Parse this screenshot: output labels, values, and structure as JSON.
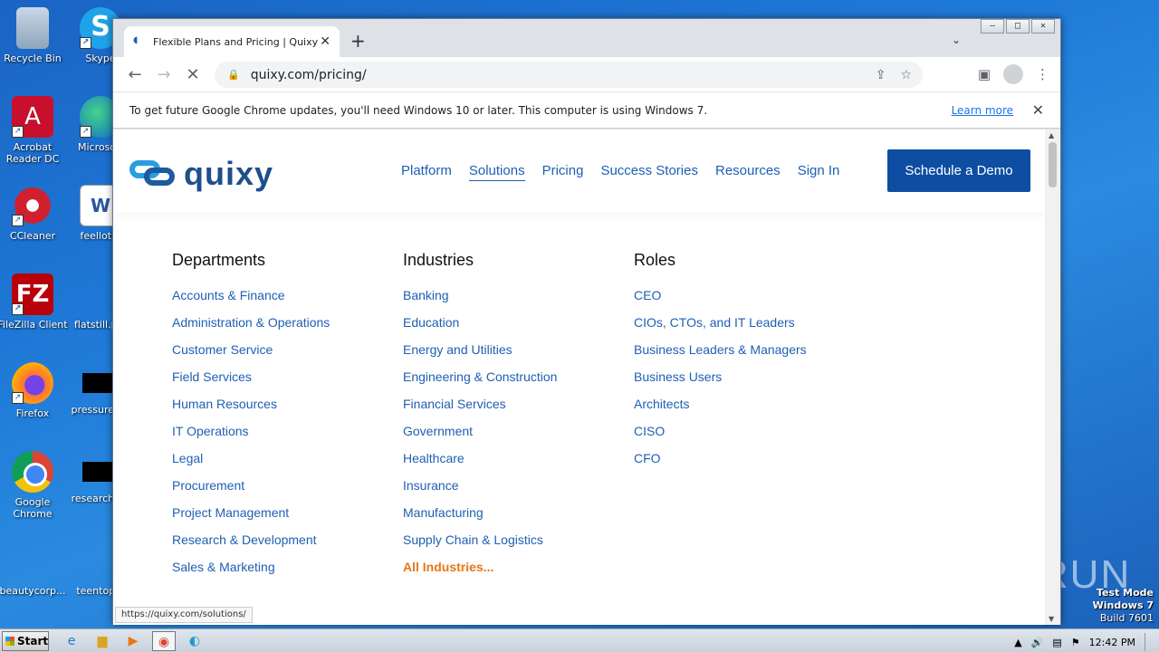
{
  "desktop": {
    "icons": [
      {
        "label": "Recycle Bin",
        "icon": "recycle-bin-icon"
      },
      {
        "label": "Skype",
        "icon": "skype-icon"
      },
      {
        "label": "Acrobat Reader DC",
        "icon": "acrobat-icon"
      },
      {
        "label": "Microsoft",
        "icon": "edge-icon"
      },
      {
        "label": "CCleaner",
        "icon": "ccleaner-icon"
      },
      {
        "label": "feellot...",
        "icon": "word-doc-icon"
      },
      {
        "label": "FileZilla Client",
        "icon": "filezilla-icon"
      },
      {
        "label": "flatstill.p...",
        "icon": "file-icon"
      },
      {
        "label": "Firefox",
        "icon": "firefox-icon"
      },
      {
        "label": "pressureb...",
        "icon": "file-icon"
      },
      {
        "label": "Google Chrome",
        "icon": "chrome-icon"
      },
      {
        "label": "researche...",
        "icon": "file-icon"
      },
      {
        "label": "beautycorp...",
        "icon": "file-icon"
      },
      {
        "label": "teentop...",
        "icon": "file-icon"
      }
    ]
  },
  "browser": {
    "tab": {
      "title": "Flexible Plans and Pricing | Quixy",
      "close": "✕"
    },
    "new_tab": "+",
    "url": "quixy.com/pricing/",
    "infobar": {
      "message": "To get future Google Chrome updates, you'll need Windows 10 or later. This computer is using Windows 7.",
      "link": "Learn more",
      "close": "✕"
    },
    "status_url": "https://quixy.com/solutions/"
  },
  "site": {
    "logo_text": "quixy",
    "nav": [
      "Platform",
      "Solutions",
      "Pricing",
      "Success Stories",
      "Resources",
      "Sign In"
    ],
    "cta": "Schedule a Demo",
    "menu": {
      "departments": {
        "heading": "Departments",
        "items": [
          "Accounts & Finance",
          "Administration & Operations",
          "Customer Service",
          "Field Services",
          "Human Resources",
          "IT Operations",
          "Legal",
          "Procurement",
          "Project Management",
          "Research & Development",
          "Sales & Marketing"
        ]
      },
      "industries": {
        "heading": "Industries",
        "items": [
          "Banking",
          "Education",
          "Energy and Utilities",
          "Engineering & Construction",
          "Financial Services",
          "Government",
          "Healthcare",
          "Insurance",
          "Manufacturing",
          "Supply Chain & Logistics"
        ],
        "more": "All Industries..."
      },
      "roles": {
        "heading": "Roles",
        "items": [
          "CEO",
          "CIOs, CTOs, and IT Leaders",
          "Business Leaders & Managers",
          "Business Users",
          "Architects",
          "CISO",
          "CFO"
        ]
      }
    }
  },
  "system": {
    "watermark": "ANY RUN",
    "test_mode": [
      "Test Mode",
      "Windows 7",
      "Build 7601"
    ],
    "start": "Start",
    "clock": "12:42 PM"
  },
  "colors": {
    "brand": "#1f5fb3",
    "cta_bg": "#0d4ea3",
    "more_link": "#e67817"
  }
}
